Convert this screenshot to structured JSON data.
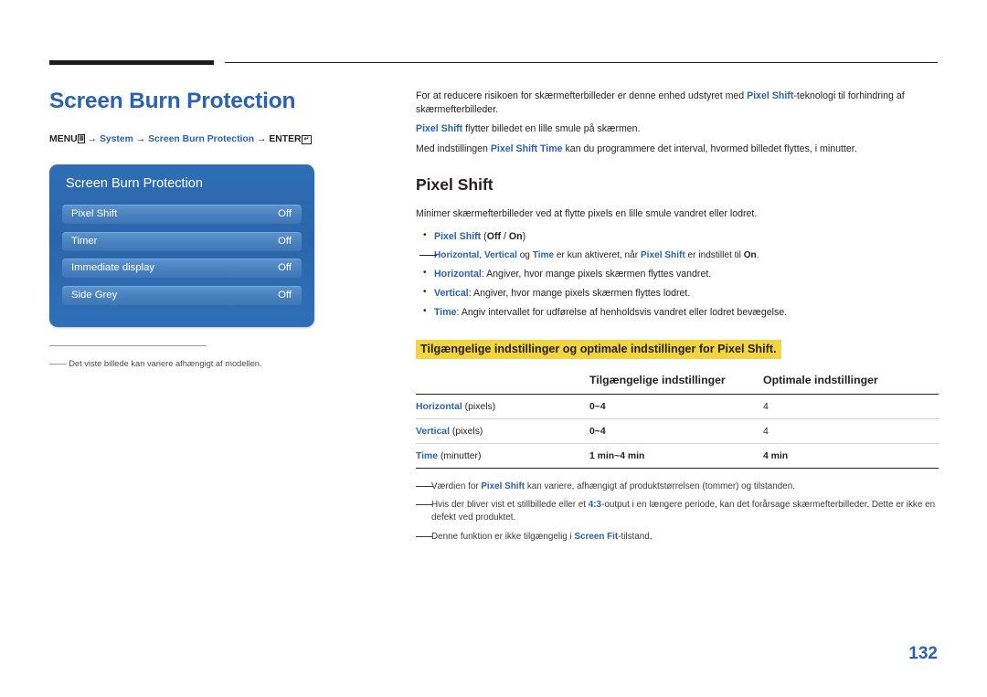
{
  "doc": {
    "title": "Screen Burn Protection",
    "page_number": "132",
    "accent_blue": "#2b62ad",
    "highlight_yellow": "#f2d441"
  },
  "menu_path": {
    "menu_label": "MENU",
    "menu_icon": "menu-grid-icon",
    "arrow": "→",
    "item1": "System",
    "item2": "Screen Burn Protection",
    "enter_label": "ENTER",
    "enter_icon": "enter-key-icon"
  },
  "osd": {
    "title": "Screen Burn Protection",
    "rows": [
      {
        "label": "Pixel Shift",
        "value": "Off"
      },
      {
        "label": "Timer",
        "value": "Off"
      },
      {
        "label": "Immediate display",
        "value": "Off"
      },
      {
        "label": "Side Grey",
        "value": "Off"
      }
    ]
  },
  "left_note": {
    "dash": "――",
    "text": "Det viste billede kan variere afhængigt af modellen."
  },
  "intro": {
    "p1_a": "For at reducere risikoen for skærmefterbilleder er denne enhed udstyret med ",
    "p1_b": "Pixel Shift",
    "p1_c": "-teknologi til forhindring af skærmefterbilleder.",
    "p2_a": "Pixel Shift",
    "p2_b": " flytter billedet en lille smule på skærmen.",
    "p3_a": "Med indstillingen ",
    "p3_b": "Pixel Shift Time",
    "p3_c": " kan du programmere det interval, hvormed billedet flyttes, i minutter."
  },
  "section": {
    "heading": "Pixel Shift",
    "description": "Minimer skærmefterbilleder ved at flytte pixels en lille smule vandret eller lodret.",
    "bullets": [
      {
        "name": "Pixel Shift",
        "rest": " (",
        "opt1": "Off",
        "sep": " / ",
        "opt2": "On",
        "rest2": ")"
      }
    ],
    "subnote": {
      "dash": "――",
      "t1": "Horizontal",
      "t2": ", ",
      "t3": "Vertical",
      "t4": " og ",
      "t5": "Time",
      "t6": " er kun aktiveret, når ",
      "t7": "Pixel Shift",
      "t8": " er indstillet til ",
      "t9": "On",
      "t10": "."
    },
    "bullets2": [
      {
        "name": "Horizontal",
        "text": ": Angiver, hvor mange pixels skærmen flyttes vandret."
      },
      {
        "name": "Vertical",
        "text": ": Angiver, hvor mange pixels skærmen flyttes lodret."
      },
      {
        "name": "Time",
        "text": ": Angiv intervallet for udførelse af henholdsvis vandret eller lodret bevægelse."
      }
    ]
  },
  "table": {
    "highlight_heading": "Tilgængelige indstillinger og optimale indstillinger for Pixel Shift.",
    "headers": [
      "",
      "Tilgængelige indstillinger",
      "Optimale indstillinger"
    ],
    "rows": [
      {
        "name": "Horizontal",
        "unit": " (pixels)",
        "available": "0~4",
        "optimal": "4"
      },
      {
        "name": "Vertical",
        "unit": " (pixels)",
        "available": "0~4",
        "optimal": "4"
      },
      {
        "name": "Time",
        "unit": " (minutter)",
        "available": "1 min~4 min",
        "optimal": "4 min"
      }
    ]
  },
  "bottom_notes": [
    {
      "dash": "――",
      "a": "Værdien for ",
      "b": "Pixel Shift",
      "c": " kan variere, afhængigt af produktstørrelsen (tommer) og tilstanden."
    },
    {
      "dash": "――",
      "a": "Hvis der bliver vist et stillbillede eller et ",
      "b": "4:3",
      "c": "-output i en længere periode, kan det forårsage skærmefterbilleder. Dette er ikke en defekt ved produktet."
    },
    {
      "dash": "――",
      "a": "Denne funktion er ikke tilgængelig i ",
      "b": "Screen Fit",
      "c": "-tilstand."
    }
  ]
}
